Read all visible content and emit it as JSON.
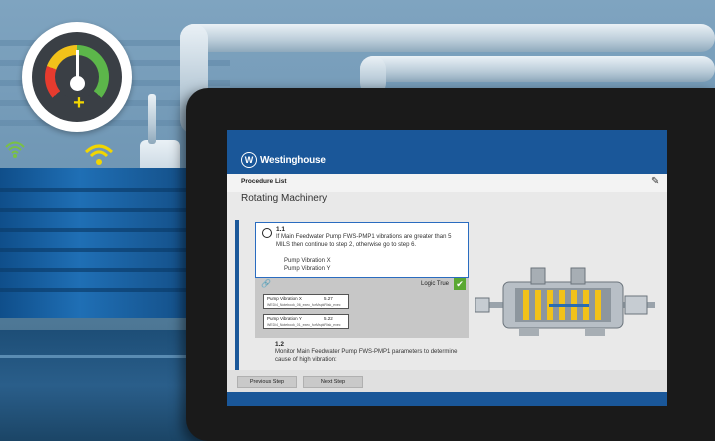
{
  "app": {
    "brand": "Westinghouse",
    "subheader": "Procedure List",
    "section_title": "Rotating Machinery"
  },
  "steps": [
    {
      "number": "1.1",
      "text": "If Main Feedwater Pump FWS-PMP1 vibrations are greater than 5 MILS then continue to step 2, otherwise go to step 6.",
      "items": [
        "Pump Vibration X",
        "Pump Vibration Y"
      ],
      "logic_label": "Logic True"
    },
    {
      "number": "1.2",
      "text": "Monitor Main Feedwater Pump FWS-PMP1 parameters to determine cause of high vibration:"
    }
  ],
  "readings": [
    {
      "name": "Pump Vibration X",
      "value": "5.27",
      "meta": "WEDi4_Notebook_06_exec_forMspkRisk_exec"
    },
    {
      "name": "Pump Vibration Y",
      "value": "5.22",
      "meta": "WEDi4_Notebook_01_exec_forMspkRisk_exec"
    }
  ],
  "buttons": {
    "previous": "Previous Step",
    "next": "Next Step"
  },
  "icons": {
    "edit": "edit-icon",
    "attachment": "paperclip-icon",
    "check": "checkmark-icon",
    "gauge": "gauge-icon",
    "wifi": "wifi-icon"
  },
  "colors": {
    "brand_blue": "#1a5799",
    "logic_true": "#5aa832",
    "gauge_red": "#e63b2e",
    "gauge_yellow": "#f2c21a",
    "gauge_green": "#5cb64a"
  }
}
